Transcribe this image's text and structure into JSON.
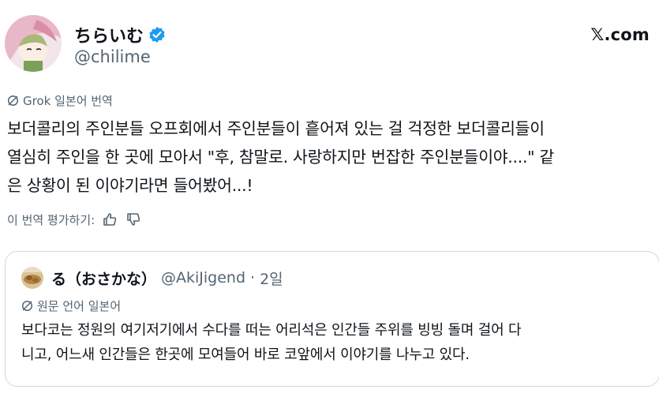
{
  "author": {
    "display_name": "ちらいむ",
    "handle": "@chilime",
    "verified": true
  },
  "brand": {
    "label": "𝕏.com"
  },
  "translation_note": "Grok 일본어 번역",
  "body_lines": [
    "보더콜리의 주인분들 오프회에서 주인분들이 흩어져 있는 걸 걱정한 보더콜리들이",
    "열심히 주인을 한 곳에 모아서 \"후, 참말로. 사랑하지만 번잡한 주인분들이야....\" 같",
    "은 상황이 된 이야기라면 들어봤어...!"
  ],
  "rate": {
    "label": "이 번역 평가하기:",
    "up_icon": "thumbs-up-icon",
    "down_icon": "thumbs-down-icon"
  },
  "quote": {
    "display_name": "る（おさかな）",
    "handle": "@AkiJigend",
    "separator": "·",
    "time": "2일",
    "note": "원문 언어 일본어",
    "lines": [
      "보다코는 정원의 여기저기에서 수다를 떠는 어리석은 인간들 주위를 빙빙 돌며 걸어 다",
      "니고, 어느새 인간들은 한곳에 모여들어 바로 코앞에서 이야기를 나누고 있다."
    ]
  },
  "colors": {
    "text": "#0f1419",
    "muted": "#536471",
    "border": "#cfd9de",
    "verified": "#1d9bf0"
  }
}
